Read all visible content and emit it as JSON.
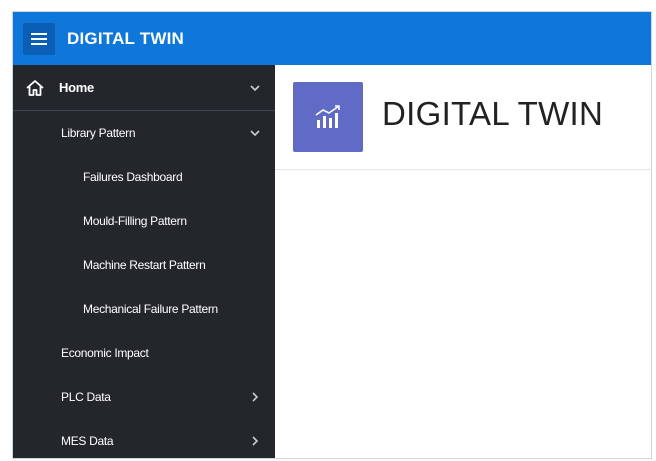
{
  "topbar": {
    "app_title": "DIGITAL TWIN",
    "menu_icon": "hamburger-icon"
  },
  "sidebar": {
    "items": [
      {
        "label": "Home",
        "icon": "home-icon",
        "expanded": true,
        "level": 0
      },
      {
        "label": "Library Pattern",
        "expanded": true,
        "level": 1
      },
      {
        "label": "Failures Dashboard",
        "level": 2
      },
      {
        "label": "Mould-Filling Pattern",
        "level": 2
      },
      {
        "label": "Machine Restart Pattern",
        "level": 2
      },
      {
        "label": "Mechanical Failure Pattern",
        "level": 2
      },
      {
        "label": "Economic Impact",
        "level": 1
      },
      {
        "label": "PLC Data",
        "level": 1,
        "has_children": true
      },
      {
        "label": "MES Data",
        "level": 1,
        "has_children": true
      }
    ]
  },
  "main": {
    "page_title": "DIGITAL TWIN",
    "logo_icon": "chart-icon"
  },
  "colors": {
    "topbar": "#0e77d9",
    "menu_button": "#0a5fb4",
    "sidebar": "#23272c",
    "logo_tile": "#5f6bc4"
  }
}
